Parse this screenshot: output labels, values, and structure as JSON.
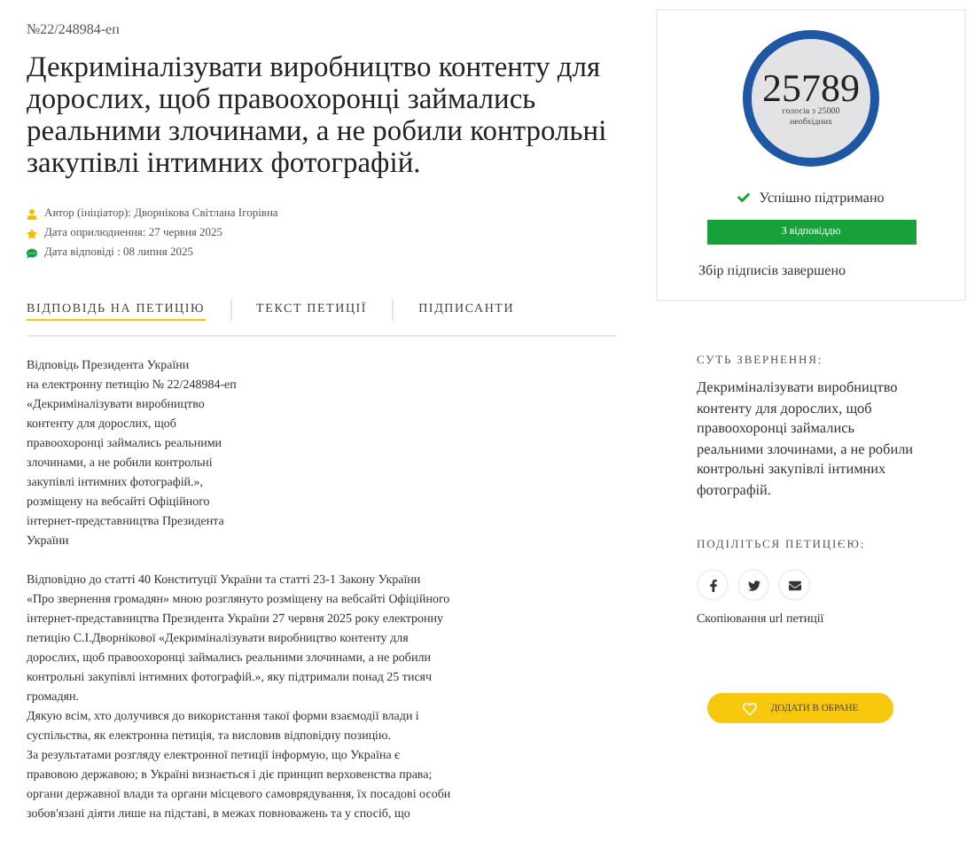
{
  "petition_number": "№22/248984-еп",
  "title": "Декриміналізувати виробництво контенту для дорослих, щоб правоохоронці займались реальними злочинами, а не робили контрольні закупівлі інтимних фотографій.",
  "meta": [
    {
      "kind": "author",
      "text": "Автор (ініціатор): Дворнікова Світлана Ігорівна"
    },
    {
      "kind": "published",
      "text": "Дата оприлюднення: 27 червня 2025"
    },
    {
      "kind": "answered",
      "text": "Дата відповіді : 08 липня 2025"
    }
  ],
  "tabs": [
    {
      "label": "ВІДПОВІДЬ НА ПЕТИЦІЮ",
      "selected": true
    },
    {
      "label": "ТЕКСТ ПЕТИЦІЇ",
      "selected": false
    },
    {
      "label": "ПІДПИСАНТИ",
      "selected": false
    }
  ],
  "answer_heading": [
    "Відповідь Президента України",
    "на електронну петицію № 22/248984-еп",
    "«Декриміналізувати виробництво",
    "контенту для дорослих, щоб",
    "правоохоронці займались реальними",
    "злочинами, а не робили контрольні",
    "закупівлі інтимних фотографій.»,",
    "розміщену на вебсайті Офіційного",
    "інтернет-представництва Президента",
    "України"
  ],
  "answer_paragraphs": [
    [
      "Відповідно до статті 40 Конституції України та статті 23-1 Закону України",
      "«Про звернення громадян» мною розглянуто розміщену на вебсайті Офіційного",
      "інтернет-представництва Президента України 27 червня 2025 року електронну",
      "петицію С.І.Дворнікової «Декриміналізувати виробництво контенту для",
      "дорослих, щоб правоохоронці займались реальними злочинами, а не робили",
      "контрольні закупівлі інтимних фотографій.», яку підтримали понад 25 тисяч",
      "громадян."
    ],
    [
      "Дякую всім, хто долучився до використання такої форми взаємодії влади і",
      "суспільства, як електронна петиція, та висловив відповідну позицію."
    ],
    [
      "За результатами розгляду електронної петиції інформую, що Україна є",
      "правовою державою; в Україні визнається і діє принцип верховенства права;",
      "органи державної влади та органи місцевого самоврядування, їх посадові особи",
      "зобов'язані діяти лише на підставі, в межах повноважень та у спосіб, що"
    ]
  ],
  "status_card": {
    "count": "25789",
    "count_caption": [
      "голосів з 25000",
      "необхідних"
    ],
    "status": "Успішно підтримано",
    "answer_badge": "З відповіддю",
    "collection_note": "Збір підписів завершено"
  },
  "summary": {
    "heading": "СУТЬ ЗВЕРНЕННЯ:",
    "text": [
      "Декриміналізувати виробництво",
      "контенту для дорослих, щоб",
      "правоохоронці займались",
      "реальними злочинами, а не робили",
      "контрольні закупівлі інтимних",
      "фотографій."
    ]
  },
  "share": {
    "heading": "ПОДІЛІТЬСЯ ПЕТИЦІЄЮ:",
    "buttons": [
      {
        "kind": "facebook"
      },
      {
        "kind": "twitter"
      },
      {
        "kind": "email"
      }
    ],
    "copy_link": "Скопіювання url петиції"
  },
  "favorite_button": "ДОДАТИ В ОБРАНЕ"
}
